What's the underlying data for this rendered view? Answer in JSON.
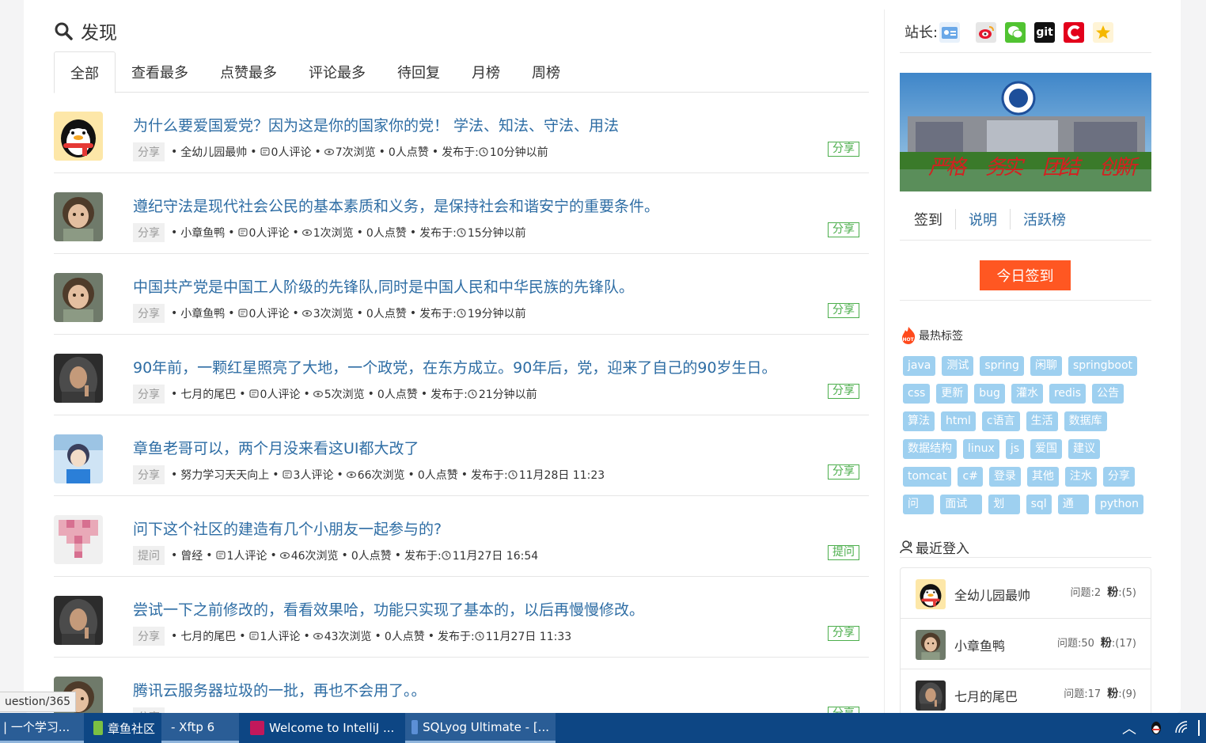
{
  "heading": "发现",
  "tabs": [
    "全部",
    "查看最多",
    "点赞最多",
    "评论最多",
    "待回复",
    "月榜",
    "周榜"
  ],
  "posts": [
    {
      "title": "为什么要爱国爱党？因为这是你的国家你的党！  学法、知法、守法、用法",
      "category": "分享",
      "author": "全幼儿园最帅",
      "comments": "0人评论",
      "views": "7次浏览",
      "likes": "0人点赞",
      "time_label": "发布于:",
      "time": "10分钟以前",
      "tag": "分享"
    },
    {
      "title": "遵纪守法是现代社会公民的基本素质和义务，是保持社会和谐安宁的重要条件。",
      "category": "分享",
      "author": "小章鱼鸭",
      "comments": "0人评论",
      "views": "1次浏览",
      "likes": "0人点赞",
      "time_label": "发布于:",
      "time": "15分钟以前",
      "tag": "分享"
    },
    {
      "title": "中国共产党是中国工人阶级的先锋队,同时是中国人民和中华民族的先锋队。",
      "category": "分享",
      "author": "小章鱼鸭",
      "comments": "0人评论",
      "views": "3次浏览",
      "likes": "0人点赞",
      "time_label": "发布于:",
      "time": "19分钟以前",
      "tag": "分享"
    },
    {
      "title": "   90年前，一颗红星照亮了大地，一个政党，在东方成立。90年后，党，迎来了自己的90岁生日。",
      "category": "分享",
      "author": "七月的尾巴",
      "comments": "0人评论",
      "views": "5次浏览",
      "likes": "0人点赞",
      "time_label": "发布于:",
      "time": "21分钟以前",
      "tag": "分享"
    },
    {
      "title": "章鱼老哥可以，两个月没来看这UI都大改了",
      "category": "分享",
      "author": "努力学习天天向上",
      "comments": "3人评论",
      "views": "66次浏览",
      "likes": "0人点赞",
      "time_label": "发布于:",
      "time": "11月28日 11:23",
      "tag": "分享"
    },
    {
      "title": "问下这个社区的建造有几个小朋友一起参与的?",
      "category": "提问",
      "author": "曾经",
      "comments": "1人评论",
      "views": "46次浏览",
      "likes": "0人点赞",
      "time_label": "发布于:",
      "time": "11月27日 16:54",
      "tag": "提问"
    },
    {
      "title": "尝试一下之前修改的，看看效果哈，功能只实现了基本的，以后再慢慢修改。",
      "category": "分享",
      "author": "七月的尾巴",
      "comments": "1人评论",
      "views": "43次浏览",
      "likes": "0人点赞",
      "time_label": "发布于:",
      "time": "11月27日 11:33",
      "tag": "分享"
    },
    {
      "title": "腾讯云服务器垃圾的一批，再也不会用了。。",
      "category": "分享",
      "author": "",
      "comments": "",
      "views": "",
      "likes": "",
      "time_label": "",
      "time": "",
      "tag": "分享"
    }
  ],
  "sidebar": {
    "owner_label": "站长:",
    "owner_icons": [
      "id-card-icon",
      "weibo-icon",
      "wechat-icon",
      "git-icon",
      "csdn-icon",
      "star-icon"
    ],
    "links": [
      "签到",
      "说明",
      "活跃榜"
    ],
    "sign_button": "今日签到",
    "hot_label": "最热标签",
    "hot_badge": "HOT",
    "tag_rows": [
      [
        "java",
        "测试",
        "spring",
        "闲聊",
        "springboot"
      ],
      [
        "css",
        "更新",
        "bug",
        "灌水",
        "redis",
        "公告"
      ],
      [
        "算法",
        "html",
        "c语言",
        "生活",
        "数据库"
      ],
      [
        "数据结构",
        "linux",
        "js",
        "爱国",
        "建议"
      ],
      [
        "tomcat",
        "c#",
        "登录",
        "其他",
        "注水",
        "分享"
      ],
      [
        "问题",
        "面试题",
        "划水",
        "sql",
        "通知",
        "python"
      ]
    ],
    "recent_label": "最近登入",
    "recent_users": [
      {
        "name": "全幼儿园最帅",
        "questions": "问题:2",
        "fans_label": "粉",
        "fans": ":(5)"
      },
      {
        "name": "小章鱼鸭",
        "questions": "问题:50",
        "fans_label": "粉",
        "fans": ":(17)"
      },
      {
        "name": "七月的尾巴",
        "questions": "问题:17",
        "fans_label": "粉",
        "fans": ":(9)"
      }
    ]
  },
  "url_hint": "uestion/365",
  "taskbar": {
    "items": [
      "| 一个学习...",
      "章鱼社区",
      "- Xftp 6",
      "Welcome to IntelliJ ...",
      "SQLyog Ultimate - [..."
    ]
  },
  "colors": {
    "link": "#2e6da4",
    "tag_green": "#4cae4c",
    "sign_orange": "#ff5722",
    "tag_blue": "#9ed0f0",
    "taskbar": "#0d4684"
  }
}
